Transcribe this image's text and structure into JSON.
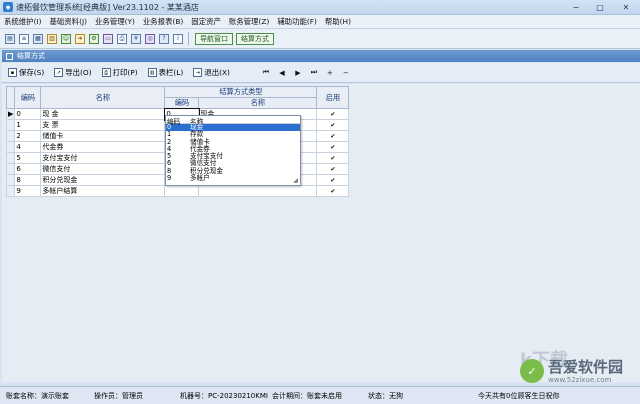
{
  "window": {
    "title": "速拓餐饮管理系统[经典版] Ver23.1102 - 某某酒店",
    "min": "−",
    "max": "□",
    "close": "✕"
  },
  "menu": [
    "系统维护(I)",
    "基础资料(J)",
    "业务管理(Y)",
    "业务报表(B)",
    "固定资产",
    "账务管理(Z)",
    "辅助功能(F)",
    "帮助(H)"
  ],
  "toolbar": {
    "icons": [
      "save-icon",
      "list-icon",
      "grid-icon",
      "table-icon",
      "people-icon",
      "arrow-icon",
      "gear-icon",
      "card-icon",
      "print-icon",
      "money-icon",
      "globe-icon",
      "help-icon",
      "info-icon"
    ],
    "nav_window": "导航窗口",
    "settle_method": "结算方式"
  },
  "panel": {
    "title": "结算方式"
  },
  "actions": {
    "save": "保存(S)",
    "export": "导出(O)",
    "print": "打印(P)",
    "columns": "表栏(L)",
    "exit": "退出(X)",
    "first": "⏮",
    "prev": "◀",
    "next": "▶",
    "last": "⏭",
    "add": "+",
    "remove": "−"
  },
  "grid": {
    "headers": {
      "code": "编码",
      "name": "名称",
      "type_group": "结算方式类型",
      "type_code": "编码",
      "type_name": "名称",
      "enabled": "启用"
    },
    "rows": [
      {
        "code": "0",
        "name": "现  金",
        "type_code": "0",
        "type_name": "现金",
        "enabled": "✔"
      },
      {
        "code": "1",
        "name": "支  票",
        "type_code": "",
        "type_name": "",
        "enabled": "✔"
      },
      {
        "code": "2",
        "name": "储值卡",
        "type_code": "",
        "type_name": "",
        "enabled": "✔"
      },
      {
        "code": "4",
        "name": "代金券",
        "type_code": "",
        "type_name": "",
        "enabled": "✔"
      },
      {
        "code": "5",
        "name": "支付宝支付",
        "type_code": "",
        "type_name": "",
        "enabled": "✔"
      },
      {
        "code": "6",
        "name": "微信支付",
        "type_code": "",
        "type_name": "",
        "enabled": "✔"
      },
      {
        "code": "8",
        "name": "积分兑现金",
        "type_code": "",
        "type_name": "",
        "enabled": "✔"
      },
      {
        "code": "9",
        "name": "多帐户结算",
        "type_code": "",
        "type_name": "",
        "enabled": "✔"
      }
    ],
    "current_row_marker": "▶"
  },
  "dropdown": {
    "head_code": "编码",
    "head_name": "名称",
    "options": [
      {
        "code": "0",
        "name": "现金"
      },
      {
        "code": "1",
        "name": "存款"
      },
      {
        "code": "2",
        "name": "储值卡"
      },
      {
        "code": "4",
        "name": "代金券"
      },
      {
        "code": "5",
        "name": "支付宝支付"
      },
      {
        "code": "6",
        "name": "微信支付"
      },
      {
        "code": "8",
        "name": "积分兑现金"
      },
      {
        "code": "9",
        "name": "多帐户"
      }
    ],
    "selected_index": 0
  },
  "status": {
    "account": "账套名称：演示账套",
    "operator": "操作员：管理员",
    "machine": "机器号：PC-20230210KMI",
    "period": "会计期间：账套未启用",
    "state": "状态：无狗",
    "notice": "今天共有0位顾客生日祝你"
  },
  "watermark": {
    "kx": "k下载",
    "name": "吾爱软件园",
    "url": "www.52zixue.com"
  }
}
